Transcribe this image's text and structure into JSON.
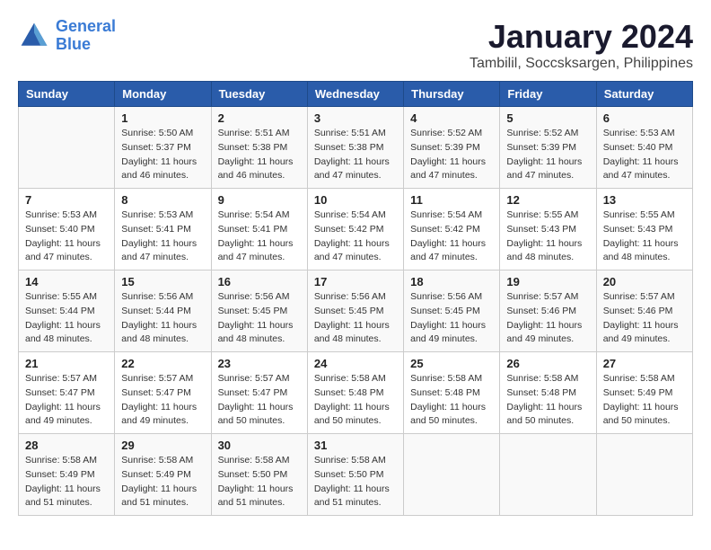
{
  "logo": {
    "line1": "General",
    "line2": "Blue"
  },
  "title": "January 2024",
  "subtitle": "Tambilil, Soccsksargen, Philippines",
  "days_of_week": [
    "Sunday",
    "Monday",
    "Tuesday",
    "Wednesday",
    "Thursday",
    "Friday",
    "Saturday"
  ],
  "weeks": [
    [
      {
        "day": "",
        "info": ""
      },
      {
        "day": "1",
        "info": "Sunrise: 5:50 AM\nSunset: 5:37 PM\nDaylight: 11 hours\nand 46 minutes."
      },
      {
        "day": "2",
        "info": "Sunrise: 5:51 AM\nSunset: 5:38 PM\nDaylight: 11 hours\nand 46 minutes."
      },
      {
        "day": "3",
        "info": "Sunrise: 5:51 AM\nSunset: 5:38 PM\nDaylight: 11 hours\nand 47 minutes."
      },
      {
        "day": "4",
        "info": "Sunrise: 5:52 AM\nSunset: 5:39 PM\nDaylight: 11 hours\nand 47 minutes."
      },
      {
        "day": "5",
        "info": "Sunrise: 5:52 AM\nSunset: 5:39 PM\nDaylight: 11 hours\nand 47 minutes."
      },
      {
        "day": "6",
        "info": "Sunrise: 5:53 AM\nSunset: 5:40 PM\nDaylight: 11 hours\nand 47 minutes."
      }
    ],
    [
      {
        "day": "7",
        "info": "Sunrise: 5:53 AM\nSunset: 5:40 PM\nDaylight: 11 hours\nand 47 minutes."
      },
      {
        "day": "8",
        "info": "Sunrise: 5:53 AM\nSunset: 5:41 PM\nDaylight: 11 hours\nand 47 minutes."
      },
      {
        "day": "9",
        "info": "Sunrise: 5:54 AM\nSunset: 5:41 PM\nDaylight: 11 hours\nand 47 minutes."
      },
      {
        "day": "10",
        "info": "Sunrise: 5:54 AM\nSunset: 5:42 PM\nDaylight: 11 hours\nand 47 minutes."
      },
      {
        "day": "11",
        "info": "Sunrise: 5:54 AM\nSunset: 5:42 PM\nDaylight: 11 hours\nand 47 minutes."
      },
      {
        "day": "12",
        "info": "Sunrise: 5:55 AM\nSunset: 5:43 PM\nDaylight: 11 hours\nand 48 minutes."
      },
      {
        "day": "13",
        "info": "Sunrise: 5:55 AM\nSunset: 5:43 PM\nDaylight: 11 hours\nand 48 minutes."
      }
    ],
    [
      {
        "day": "14",
        "info": "Sunrise: 5:55 AM\nSunset: 5:44 PM\nDaylight: 11 hours\nand 48 minutes."
      },
      {
        "day": "15",
        "info": "Sunrise: 5:56 AM\nSunset: 5:44 PM\nDaylight: 11 hours\nand 48 minutes."
      },
      {
        "day": "16",
        "info": "Sunrise: 5:56 AM\nSunset: 5:45 PM\nDaylight: 11 hours\nand 48 minutes."
      },
      {
        "day": "17",
        "info": "Sunrise: 5:56 AM\nSunset: 5:45 PM\nDaylight: 11 hours\nand 48 minutes."
      },
      {
        "day": "18",
        "info": "Sunrise: 5:56 AM\nSunset: 5:45 PM\nDaylight: 11 hours\nand 49 minutes."
      },
      {
        "day": "19",
        "info": "Sunrise: 5:57 AM\nSunset: 5:46 PM\nDaylight: 11 hours\nand 49 minutes."
      },
      {
        "day": "20",
        "info": "Sunrise: 5:57 AM\nSunset: 5:46 PM\nDaylight: 11 hours\nand 49 minutes."
      }
    ],
    [
      {
        "day": "21",
        "info": "Sunrise: 5:57 AM\nSunset: 5:47 PM\nDaylight: 11 hours\nand 49 minutes."
      },
      {
        "day": "22",
        "info": "Sunrise: 5:57 AM\nSunset: 5:47 PM\nDaylight: 11 hours\nand 49 minutes."
      },
      {
        "day": "23",
        "info": "Sunrise: 5:57 AM\nSunset: 5:47 PM\nDaylight: 11 hours\nand 50 minutes."
      },
      {
        "day": "24",
        "info": "Sunrise: 5:58 AM\nSunset: 5:48 PM\nDaylight: 11 hours\nand 50 minutes."
      },
      {
        "day": "25",
        "info": "Sunrise: 5:58 AM\nSunset: 5:48 PM\nDaylight: 11 hours\nand 50 minutes."
      },
      {
        "day": "26",
        "info": "Sunrise: 5:58 AM\nSunset: 5:48 PM\nDaylight: 11 hours\nand 50 minutes."
      },
      {
        "day": "27",
        "info": "Sunrise: 5:58 AM\nSunset: 5:49 PM\nDaylight: 11 hours\nand 50 minutes."
      }
    ],
    [
      {
        "day": "28",
        "info": "Sunrise: 5:58 AM\nSunset: 5:49 PM\nDaylight: 11 hours\nand 51 minutes."
      },
      {
        "day": "29",
        "info": "Sunrise: 5:58 AM\nSunset: 5:49 PM\nDaylight: 11 hours\nand 51 minutes."
      },
      {
        "day": "30",
        "info": "Sunrise: 5:58 AM\nSunset: 5:50 PM\nDaylight: 11 hours\nand 51 minutes."
      },
      {
        "day": "31",
        "info": "Sunrise: 5:58 AM\nSunset: 5:50 PM\nDaylight: 11 hours\nand 51 minutes."
      },
      {
        "day": "",
        "info": ""
      },
      {
        "day": "",
        "info": ""
      },
      {
        "day": "",
        "info": ""
      }
    ]
  ]
}
